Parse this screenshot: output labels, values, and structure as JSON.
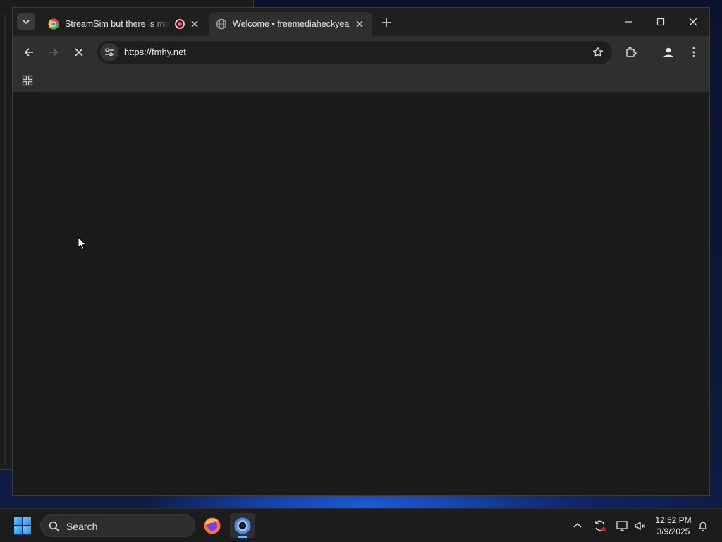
{
  "browser": {
    "tabs": [
      {
        "title": "StreamSim but there is mor",
        "active": false,
        "favicon": "chrome-color-favicon",
        "recording": true
      },
      {
        "title": "Welcome • freemediaheckyeah",
        "active": true,
        "favicon": "globe-favicon"
      }
    ],
    "address": {
      "url": "https://fmhy.net"
    },
    "state": "loading"
  },
  "taskbar": {
    "search_label": "Search",
    "apps": [
      "firefox-icon",
      "chrome-icon"
    ],
    "clock": {
      "time": "12:52 PM",
      "date": "3/9/2025"
    }
  },
  "colors": {
    "browser_frame": "#1f1f1f",
    "toolbar": "#2f2f2f",
    "content": "#1b1b1b",
    "taskbar": "#1c1c1c",
    "accent": "#60b8ff"
  }
}
